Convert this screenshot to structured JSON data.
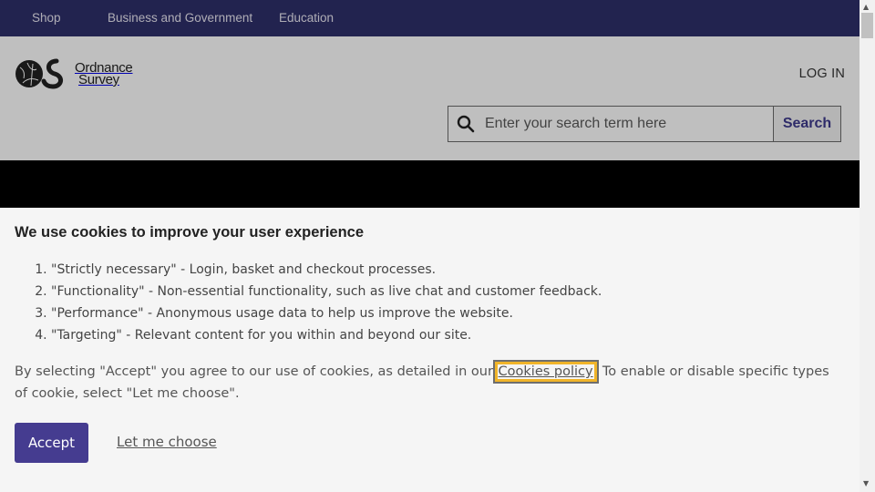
{
  "topnav": {
    "items": [
      "Shop",
      "Business and Government",
      "Education"
    ]
  },
  "header": {
    "logo_line1": "Ordnance",
    "logo_line2": "Survey",
    "login": "LOG IN"
  },
  "search": {
    "placeholder": "Enter your search term here",
    "button": "Search"
  },
  "cookie": {
    "title": "We use cookies to improve your user experience",
    "items": [
      "\"Strictly necessary\" - Login, basket and checkout processes.",
      "\"Functionality\" - Non-essential functionality, such as live chat and customer feedback.",
      "\"Performance\" - Anonymous usage data to help us improve the website.",
      "\"Targeting\" - Relevant content for you within and beyond our site."
    ],
    "text_before": "By selecting \"Accept\" you agree to our use of cookies, as detailed in our ",
    "policy_link": "Cookies policy",
    "text_after": ". To enable or disable specific types of cookie, select \"Let me choose\".",
    "accept": "Accept",
    "choose": "Let me choose"
  },
  "colors": {
    "nav_bg": "#2e2f6a",
    "accent": "#453c90",
    "focus": "#f0b429"
  }
}
